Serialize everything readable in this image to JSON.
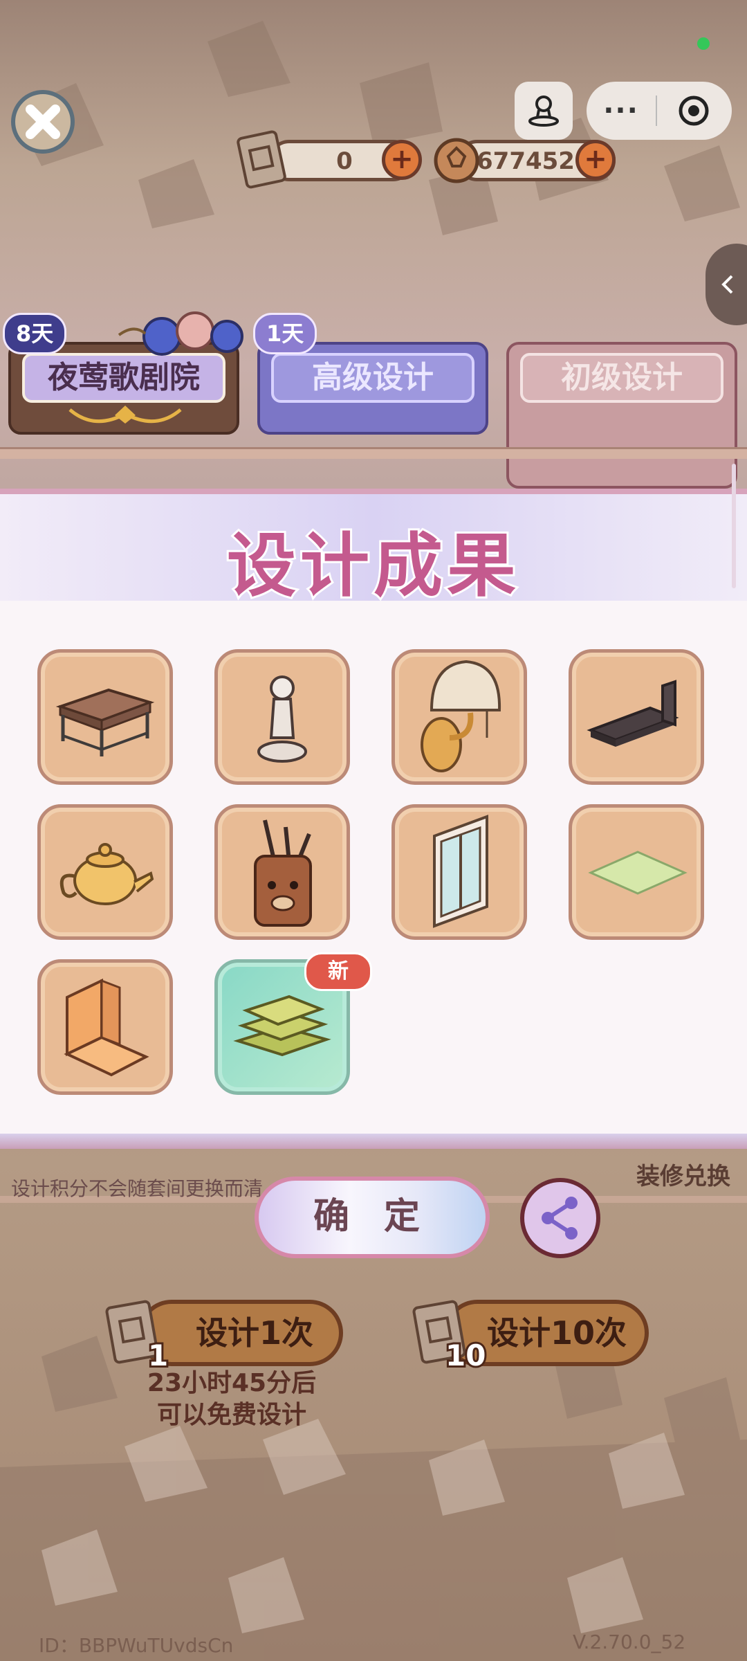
{
  "status": {
    "indicator_color": "#34c759"
  },
  "hud": {
    "close_icon": "close-x-icon",
    "avatar_icon": "user-stamp-icon",
    "more_label": "···",
    "target_icon": "target-icon",
    "ticket_count": "0",
    "coin_count": "677452",
    "plus_label": "+"
  },
  "tabs": [
    {
      "label": "夜莺歌剧院",
      "badge": "8天"
    },
    {
      "label": "高级设计",
      "badge": "1天"
    },
    {
      "label": "初级设计"
    }
  ],
  "modal": {
    "title": "设计成果",
    "items": [
      {
        "name": "coffee-table",
        "icon": "coffee-table-icon"
      },
      {
        "name": "chess-pawn",
        "icon": "pawn-icon"
      },
      {
        "name": "wall-lamp",
        "icon": "wall-lamp-icon"
      },
      {
        "name": "dark-bench",
        "icon": "bench-icon"
      },
      {
        "name": "teapot",
        "icon": "teapot-icon"
      },
      {
        "name": "pen-holder",
        "icon": "pen-holder-icon"
      },
      {
        "name": "window",
        "icon": "window-icon"
      },
      {
        "name": "green-rug",
        "icon": "rug-icon"
      },
      {
        "name": "orange-chair",
        "icon": "chair-icon"
      },
      {
        "name": "book-stack",
        "icon": "books-icon",
        "is_new": true
      }
    ],
    "new_badge": "新",
    "confirm_label": "确 定"
  },
  "bottom": {
    "note": "设计积分不会随套间更换而清",
    "exchange_label": "装修兑换",
    "share_icon": "share-icon",
    "design_once_label": "设计1次",
    "design_once_cost": "1",
    "design_ten_label": "设计10次",
    "design_ten_cost": "10",
    "timer_line1": "23小时45分后",
    "timer_line2": "可以免费设计"
  },
  "footer": {
    "id_text": "ID：BBPWuTUvdsCn",
    "version": "V.2.70.0_52"
  }
}
